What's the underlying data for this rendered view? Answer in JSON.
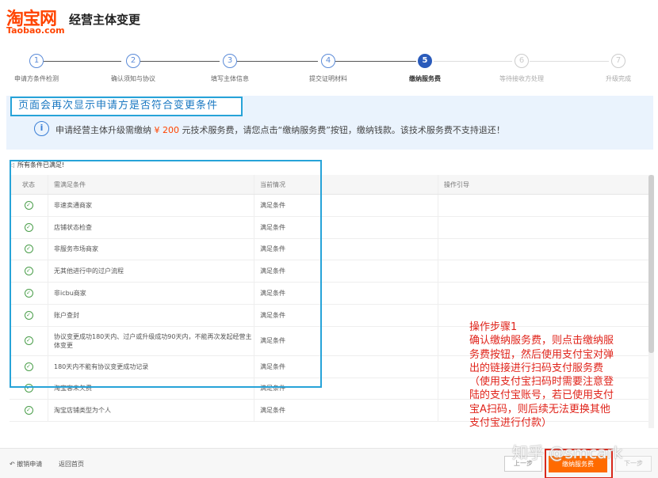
{
  "header": {
    "logo_cn": "淘宝网",
    "logo_en": "Taobao.com",
    "title": "经营主体变更"
  },
  "steps": [
    {
      "num": "1",
      "label": "申请方条件检测",
      "state": "done"
    },
    {
      "num": "2",
      "label": "确认须知与协议",
      "state": "done"
    },
    {
      "num": "3",
      "label": "填写主体信息",
      "state": "done"
    },
    {
      "num": "4",
      "label": "提交证明材料",
      "state": "done"
    },
    {
      "num": "5",
      "label": "缴纳服务费",
      "state": "active"
    },
    {
      "num": "6",
      "label": "等待接收方处理",
      "state": "inactive"
    },
    {
      "num": "7",
      "label": "升级完成",
      "state": "inactive"
    }
  ],
  "annotation_top": "页面会再次显示申请方是否符合变更条件",
  "notice": {
    "icon": "info-icon",
    "before": "申请经营主体升级需缴纳",
    "amount": "¥ 200",
    "after": "元技术服务费，请您点击“缴纳服务费”按钮，缴纳钱款。该技术服务费不支持退还！"
  },
  "conditions": {
    "header": "所有条件已满足!",
    "icon": "speaker-icon",
    "columns": [
      "状态",
      "需满足条件",
      "当前情况",
      "操作引导"
    ],
    "rows": [
      {
        "condition": "非速卖通商家",
        "status": "满足条件"
      },
      {
        "condition": "店铺状态检查",
        "status": "满足条件"
      },
      {
        "condition": "非服务市场商家",
        "status": "满足条件"
      },
      {
        "condition": "无其他进行中的过户流程",
        "status": "满足条件"
      },
      {
        "condition": "非icbu商家",
        "status": "满足条件"
      },
      {
        "condition": "账户查封",
        "status": "满足条件"
      },
      {
        "condition": "协议变更成功180天内、过户或升级成功90天内，不能再次发起经营主体变更",
        "status": "满足条件"
      },
      {
        "condition": "180天内不能有协议变更成功记录",
        "status": "满足条件"
      },
      {
        "condition": "淘宝客未欠费",
        "status": "满足条件"
      },
      {
        "condition": "淘宝店铺类型为个人",
        "status": "满足条件"
      }
    ]
  },
  "annotation_red": [
    "操作步骤1",
    "确认缴纳服务费，则点击缴纳服",
    "务费按钮，然后使用支付宝对弹",
    "出的链接进行扫码支付服务费",
    "（使用支付宝扫码时需要注意登",
    "陆的支付宝账号，若已使用支付",
    "宝A扫码，则后续无法更换其他",
    "支付宝进行付款）"
  ],
  "footer": {
    "cancel": "撤销申请",
    "cancel_icon": "undo-icon",
    "home": "返回首页",
    "prev": "上一步",
    "pay": "缴纳服务费",
    "next": "下一步"
  },
  "watermark": "知乎 @smcark",
  "colors": {
    "brand": "#ff4400",
    "step_active": "#2a5bbb",
    "annotation_blue": "#27a3d8",
    "annotation_red": "#e0241b",
    "pay_button": "#ff6a00"
  }
}
